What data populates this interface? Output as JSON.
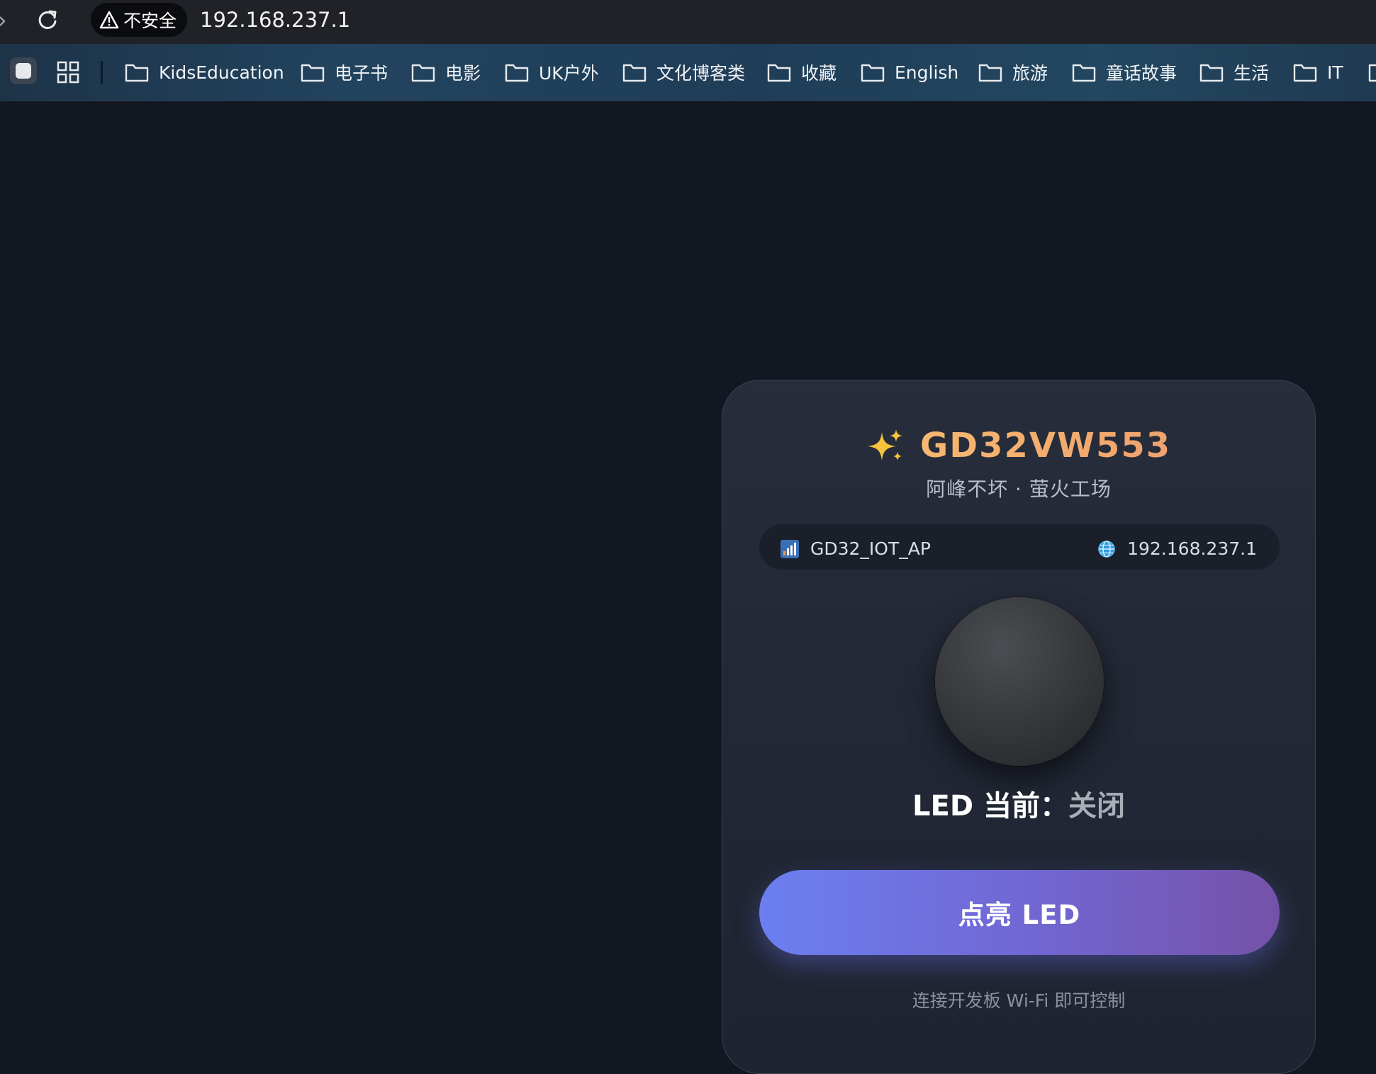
{
  "browser": {
    "security_label": "不安全",
    "url": "192.168.237.1"
  },
  "bookmarks": [
    {
      "label": "KidsEducation"
    },
    {
      "label": "电子书"
    },
    {
      "label": "电影"
    },
    {
      "label": "UK户外"
    },
    {
      "label": "文化博客类"
    },
    {
      "label": "收藏"
    },
    {
      "label": "English"
    },
    {
      "label": "旅游"
    },
    {
      "label": "童话故事"
    },
    {
      "label": "生活"
    },
    {
      "label": "IT"
    }
  ],
  "card": {
    "title": "GD32VW553",
    "subtitle": "阿峰不坏 · 萤火工场",
    "ssid": "GD32_IOT_AP",
    "ip": "192.168.237.1",
    "status_label": "LED 当前：",
    "status_value": "关闭",
    "button_label": "点亮 LED",
    "hint": "连接开发板 Wi-Fi 即可控制"
  },
  "icons": [
    "reload-icon",
    "warning-icon",
    "folder-icon",
    "apps-icon",
    "sparkle-icon",
    "signal-bars-icon",
    "globe-icon"
  ],
  "colors": {
    "page_bg": "#121722",
    "title_accent": "#f6b870",
    "button_start": "#6b7ff0",
    "button_end": "#7552a8"
  }
}
